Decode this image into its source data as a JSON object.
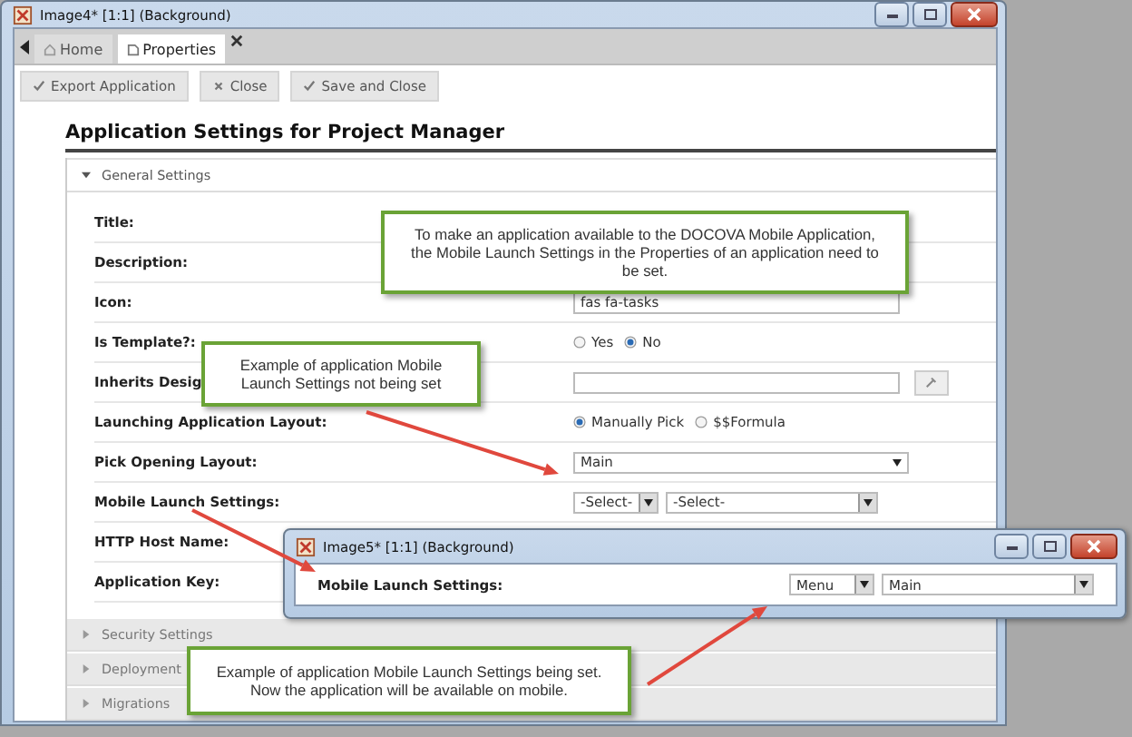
{
  "window": {
    "title": "Image4* [1:1] (Background)"
  },
  "tabs": [
    {
      "label": "Home",
      "selected": false,
      "kind": "home"
    },
    {
      "label": "Properties",
      "selected": true,
      "kind": "page"
    }
  ],
  "toolbar": [
    {
      "label": "Export Application",
      "kind": "confirm"
    },
    {
      "label": "Close",
      "kind": "cancel"
    },
    {
      "label": "Save and Close",
      "kind": "confirm"
    }
  ],
  "heading": "Application Settings for Project Manager",
  "sections": [
    {
      "title": "General Settings",
      "expanded": true,
      "fields": [
        {
          "label": "Title:",
          "kind": "blank"
        },
        {
          "label": "Description:",
          "kind": "blank"
        },
        {
          "label": "Icon:",
          "kind": "text",
          "value": "fas fa-tasks"
        },
        {
          "label": "Is Template?:",
          "kind": "radio",
          "options": [
            {
              "label": "Yes",
              "selected": false
            },
            {
              "label": "No",
              "selected": true
            }
          ]
        },
        {
          "label": "Inherits Desig",
          "kind": "text-button"
        },
        {
          "label": "Launching Application Layout:",
          "kind": "radio",
          "options": [
            {
              "label": "Manually Pick",
              "selected": true
            },
            {
              "label": "$$Formula",
              "selected": false
            }
          ]
        },
        {
          "label": "Pick Opening Layout:",
          "kind": "select",
          "value": "Main"
        },
        {
          "label": "Mobile Launch Settings:",
          "kind": "select-pair",
          "values": [
            "-Select-",
            "-Select-"
          ]
        },
        {
          "label": "HTTP Host Name:",
          "kind": "blank"
        },
        {
          "label": "Application Key:",
          "kind": "blank"
        }
      ]
    },
    {
      "title": "Security Settings",
      "expanded": false
    },
    {
      "title": "Deployment",
      "expanded": false
    },
    {
      "title": "Migrations",
      "expanded": false
    }
  ],
  "inset_window": {
    "title": "Image5* [1:1] (Background)",
    "field": {
      "label": "Mobile Launch Settings:",
      "values": [
        "Menu",
        "Main"
      ]
    }
  },
  "callouts": [
    {
      "text": "To make an application available to the DOCOVA Mobile Application, the Mobile Launch Settings in the Properties of an application need to be set."
    },
    {
      "text": "Example of application Mobile Launch Settings not being set"
    },
    {
      "text": "Example of application Mobile Launch Settings being set.  Now the application will be available on mobile."
    }
  ]
}
